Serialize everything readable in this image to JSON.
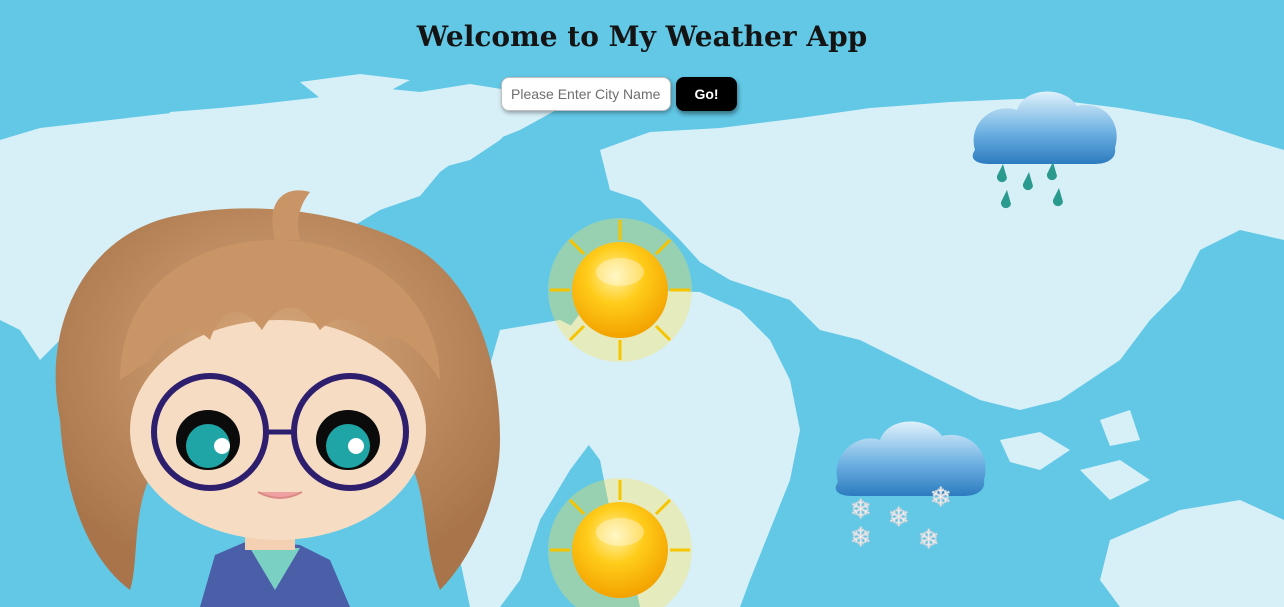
{
  "header": {
    "title": "Welcome to My Weather App"
  },
  "search": {
    "placeholder": "Please Enter City Name",
    "value": "",
    "button_label": "Go!"
  },
  "theme": {
    "sky": "#62c8e6",
    "land": "#d7f0f8",
    "button": "#000000",
    "title_color": "#141414"
  },
  "icons": [
    "world-map",
    "character",
    "sun-icon",
    "sun-icon",
    "rain-cloud-icon",
    "snow-cloud-icon"
  ]
}
